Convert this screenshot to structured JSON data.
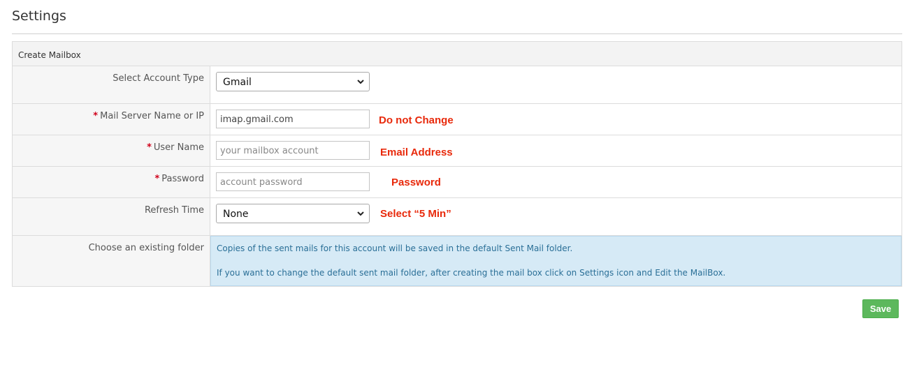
{
  "page": {
    "title": "Settings"
  },
  "panel": {
    "title": "Create Mailbox"
  },
  "form": {
    "account_type": {
      "label": "Select Account Type",
      "value": "Gmail"
    },
    "mail_server": {
      "label": "Mail Server Name or IP",
      "required": "*",
      "value": "imap.gmail.com",
      "annotation": "Do not Change"
    },
    "user_name": {
      "label": "User Name",
      "required": "*",
      "placeholder": "your mailbox account",
      "annotation": "Email Address"
    },
    "password": {
      "label": "Password",
      "required": "*",
      "placeholder": "account password",
      "annotation": "Password"
    },
    "refresh_time": {
      "label": "Refresh Time",
      "value": "None",
      "annotation": "Select “5 Min”"
    },
    "folder": {
      "label": "Choose an existing folder",
      "info_line1": "Copies of the sent mails for this account will be saved in the default Sent Mail folder.",
      "info_line2": "If you want to change the default sent mail folder, after creating the mail box click on Settings icon and Edit the MailBox."
    }
  },
  "actions": {
    "save_label": "Save"
  },
  "icons": {
    "select_arrow": "chevron-down-icon"
  },
  "colors": {
    "annotation": "#e8290b",
    "save": "#5cb85c",
    "info_bg": "#d6eaf6",
    "required": "#d0021b"
  }
}
